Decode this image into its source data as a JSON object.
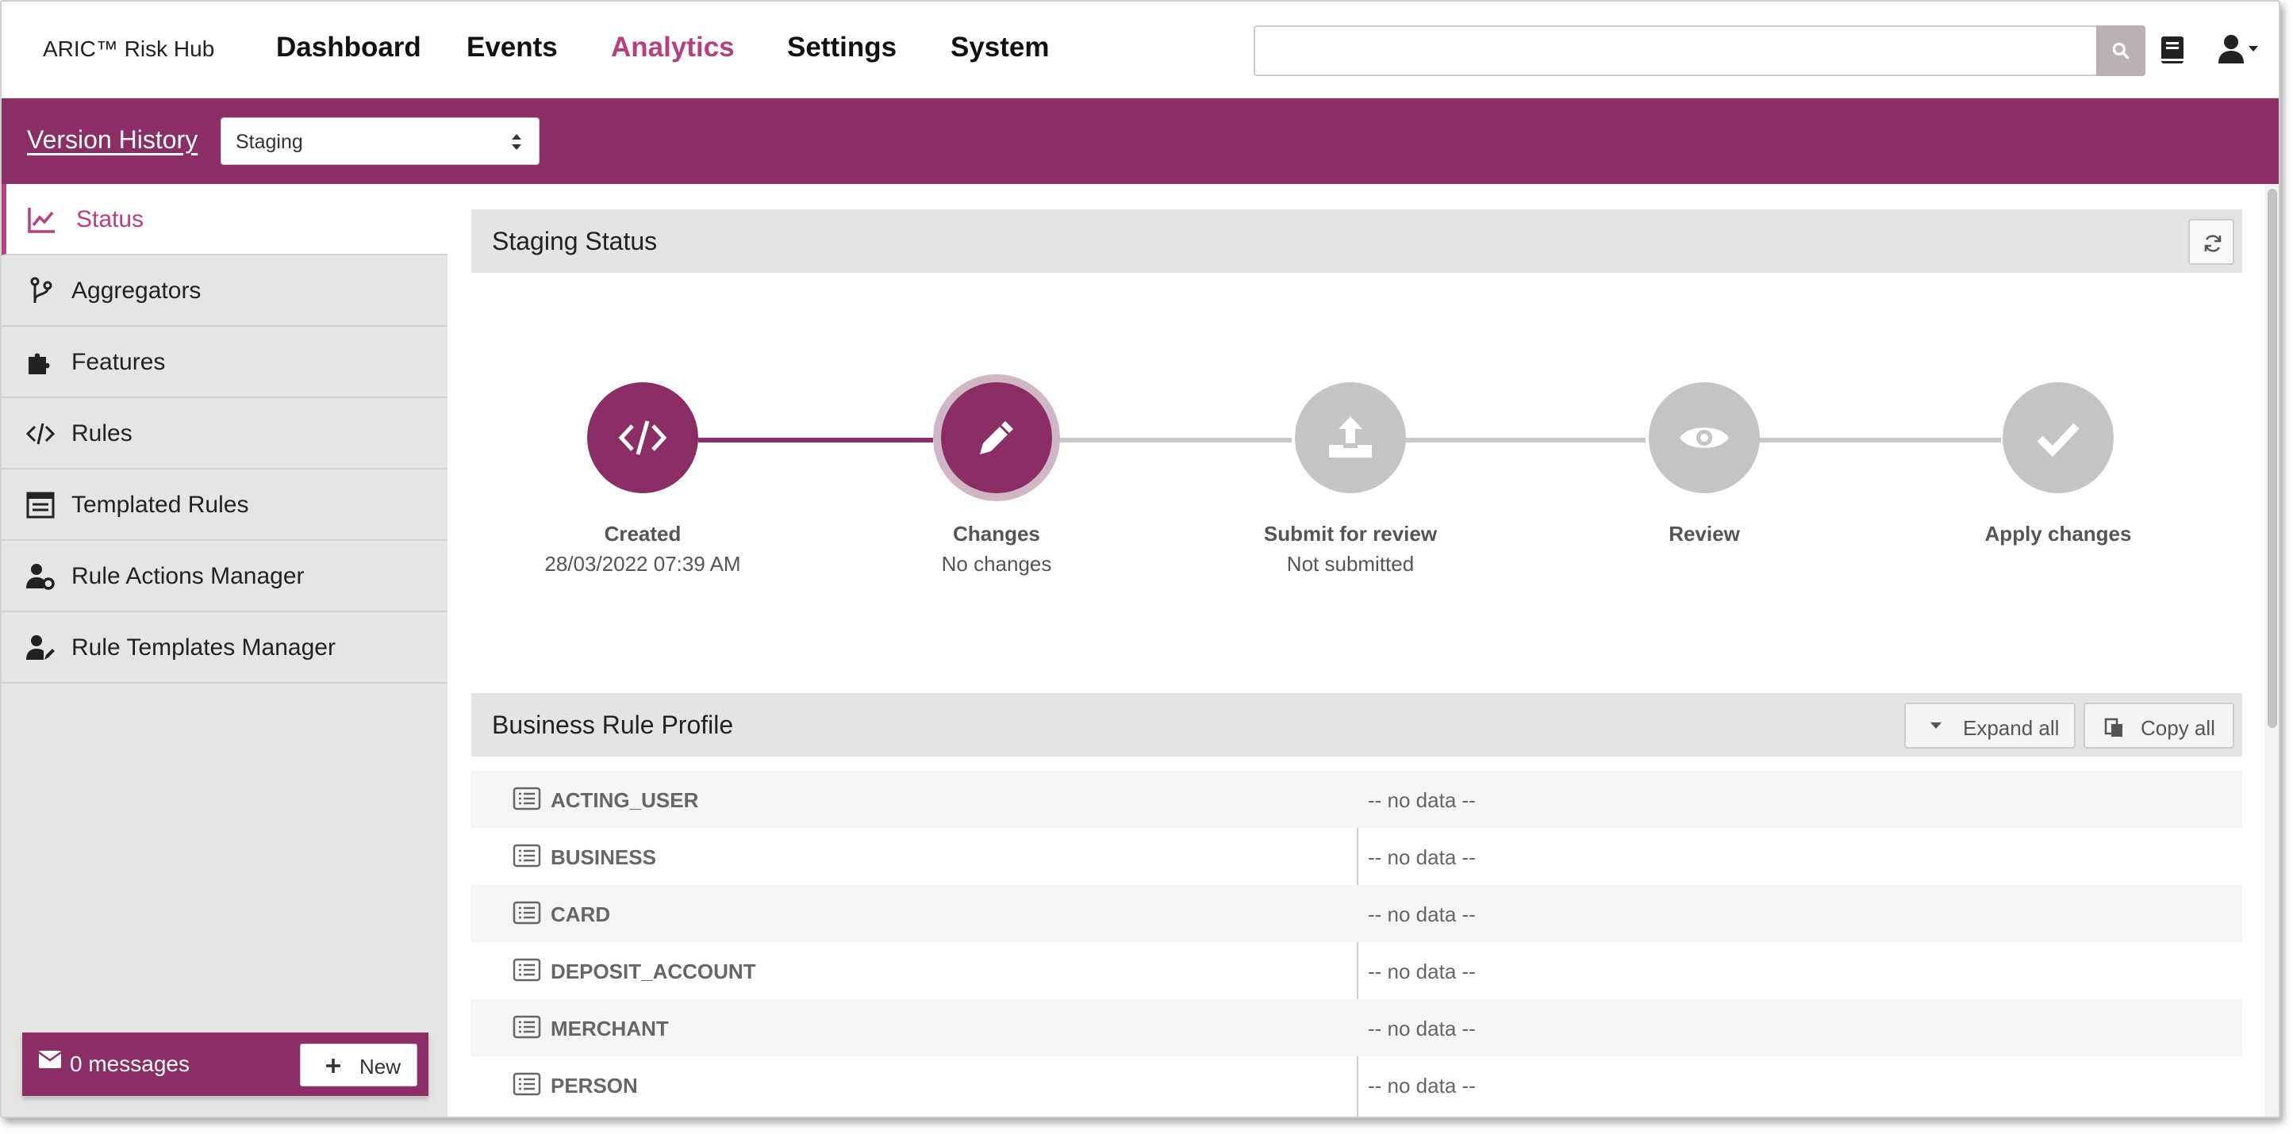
{
  "app": {
    "brand": "ARIC™ Risk Hub"
  },
  "nav": {
    "items": [
      {
        "label": "Dashboard",
        "active": false
      },
      {
        "label": "Events",
        "active": false
      },
      {
        "label": "Analytics",
        "active": true
      },
      {
        "label": "Settings",
        "active": false
      },
      {
        "label": "System",
        "active": false
      }
    ],
    "search_value": "",
    "icons": {
      "search": "search-icon",
      "docs": "book-icon",
      "user": "user-icon"
    }
  },
  "subbar": {
    "version_history_label": "Version History",
    "environment_selected": "Staging"
  },
  "sidebar": {
    "items": [
      {
        "label": "Status",
        "icon": "chart-line-icon",
        "active": true
      },
      {
        "label": "Aggregators",
        "icon": "branch-icon",
        "active": false
      },
      {
        "label": "Features",
        "icon": "puzzle-icon",
        "active": false
      },
      {
        "label": "Rules",
        "icon": "code-icon",
        "active": false
      },
      {
        "label": "Templated Rules",
        "icon": "window-list-icon",
        "active": false
      },
      {
        "label": "Rule Actions Manager",
        "icon": "user-gear-icon",
        "active": false
      },
      {
        "label": "Rule Templates Manager",
        "icon": "user-edit-icon",
        "active": false
      }
    ],
    "messages": {
      "label": "0 messages",
      "new_label": "New"
    }
  },
  "status_panel": {
    "title": "Staging Status",
    "steps": [
      {
        "label": "Created",
        "sub": "28/03/2022 07:39 AM",
        "state": "done",
        "icon": "code-icon"
      },
      {
        "label": "Changes",
        "sub": "No changes",
        "state": "current",
        "icon": "pencil-icon"
      },
      {
        "label": "Submit for review",
        "sub": "Not submitted",
        "state": "pending",
        "icon": "upload-icon"
      },
      {
        "label": "Review",
        "sub": "",
        "state": "pending",
        "icon": "eye-icon"
      },
      {
        "label": "Apply changes",
        "sub": "",
        "state": "pending",
        "icon": "check-icon"
      }
    ],
    "colors": {
      "active": "#8b2e66",
      "pending": "#c4c4c4",
      "accent": "#b5407f"
    }
  },
  "profile_panel": {
    "title": "Business Rule Profile",
    "expand_label": "Expand all",
    "copy_label": "Copy all",
    "rows": [
      {
        "key": "ACTING_USER",
        "value": "-- no data --"
      },
      {
        "key": "BUSINESS",
        "value": "-- no data --"
      },
      {
        "key": "CARD",
        "value": "-- no data --"
      },
      {
        "key": "DEPOSIT_ACCOUNT",
        "value": "-- no data --"
      },
      {
        "key": "MERCHANT",
        "value": "-- no data --"
      },
      {
        "key": "PERSON",
        "value": "-- no data --"
      }
    ]
  }
}
